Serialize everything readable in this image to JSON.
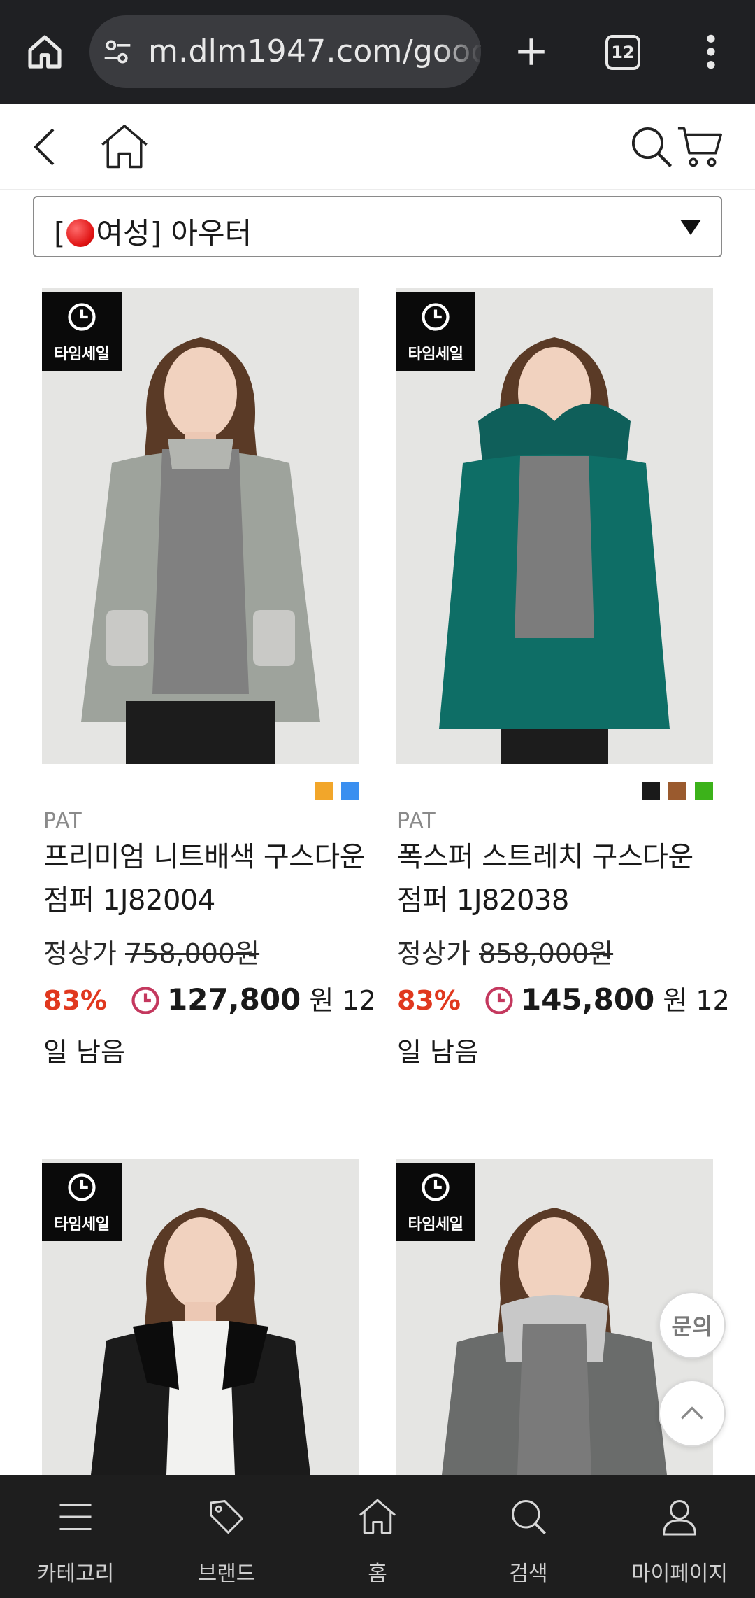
{
  "browser": {
    "url": "m.dlm1947.com/goods",
    "tab_count": "12",
    "icons": [
      "home-icon",
      "tune-icon",
      "plus-icon",
      "tabs-icon",
      "more-vert-icon"
    ]
  },
  "header": {
    "icons": [
      "back-arrow-icon",
      "home-icon",
      "search-icon",
      "cart-icon"
    ]
  },
  "category": {
    "label_open": "[",
    "label_rest": "여성] 아우터"
  },
  "products": [
    {
      "badge": "타임세일",
      "swatches": [
        "#f2a62a",
        "#3a8ff0"
      ],
      "brand": "PAT",
      "name": "프리미엄 니트배색 구스다운 점퍼 1J82004",
      "regular_label": "정상가",
      "regular_price": "758,000원",
      "discount": "83%",
      "sale_price": "127,800",
      "currency_remaining": "원 12일 남음"
    },
    {
      "badge": "타임세일",
      "swatches": [
        "#1a1a1a",
        "#9a5a2e",
        "#3cb21a"
      ],
      "brand": "PAT",
      "name": "폭스퍼 스트레치 구스다운 점퍼 1J82038",
      "regular_label": "정상가",
      "regular_price": "858,000원",
      "discount": "83%",
      "sale_price": "145,800",
      "currency_remaining": "원 12일 남음"
    },
    {
      "badge": "타임세일"
    },
    {
      "badge": "타임세일"
    }
  ],
  "floating": {
    "inquiry": "문의",
    "icons": [
      "chevron-up-icon"
    ]
  },
  "bottom_nav": [
    {
      "label": "카테고리",
      "icon": "menu-icon"
    },
    {
      "label": "브랜드",
      "icon": "tag-icon"
    },
    {
      "label": "홈",
      "icon": "home-icon"
    },
    {
      "label": "검색",
      "icon": "search-icon"
    },
    {
      "label": "마이페이지",
      "icon": "user-icon"
    }
  ],
  "colors": {
    "discount": "#e0381e",
    "sale_clock": "#c4385e",
    "chrome": "#1f2023",
    "nav": "#1e1e1e"
  }
}
